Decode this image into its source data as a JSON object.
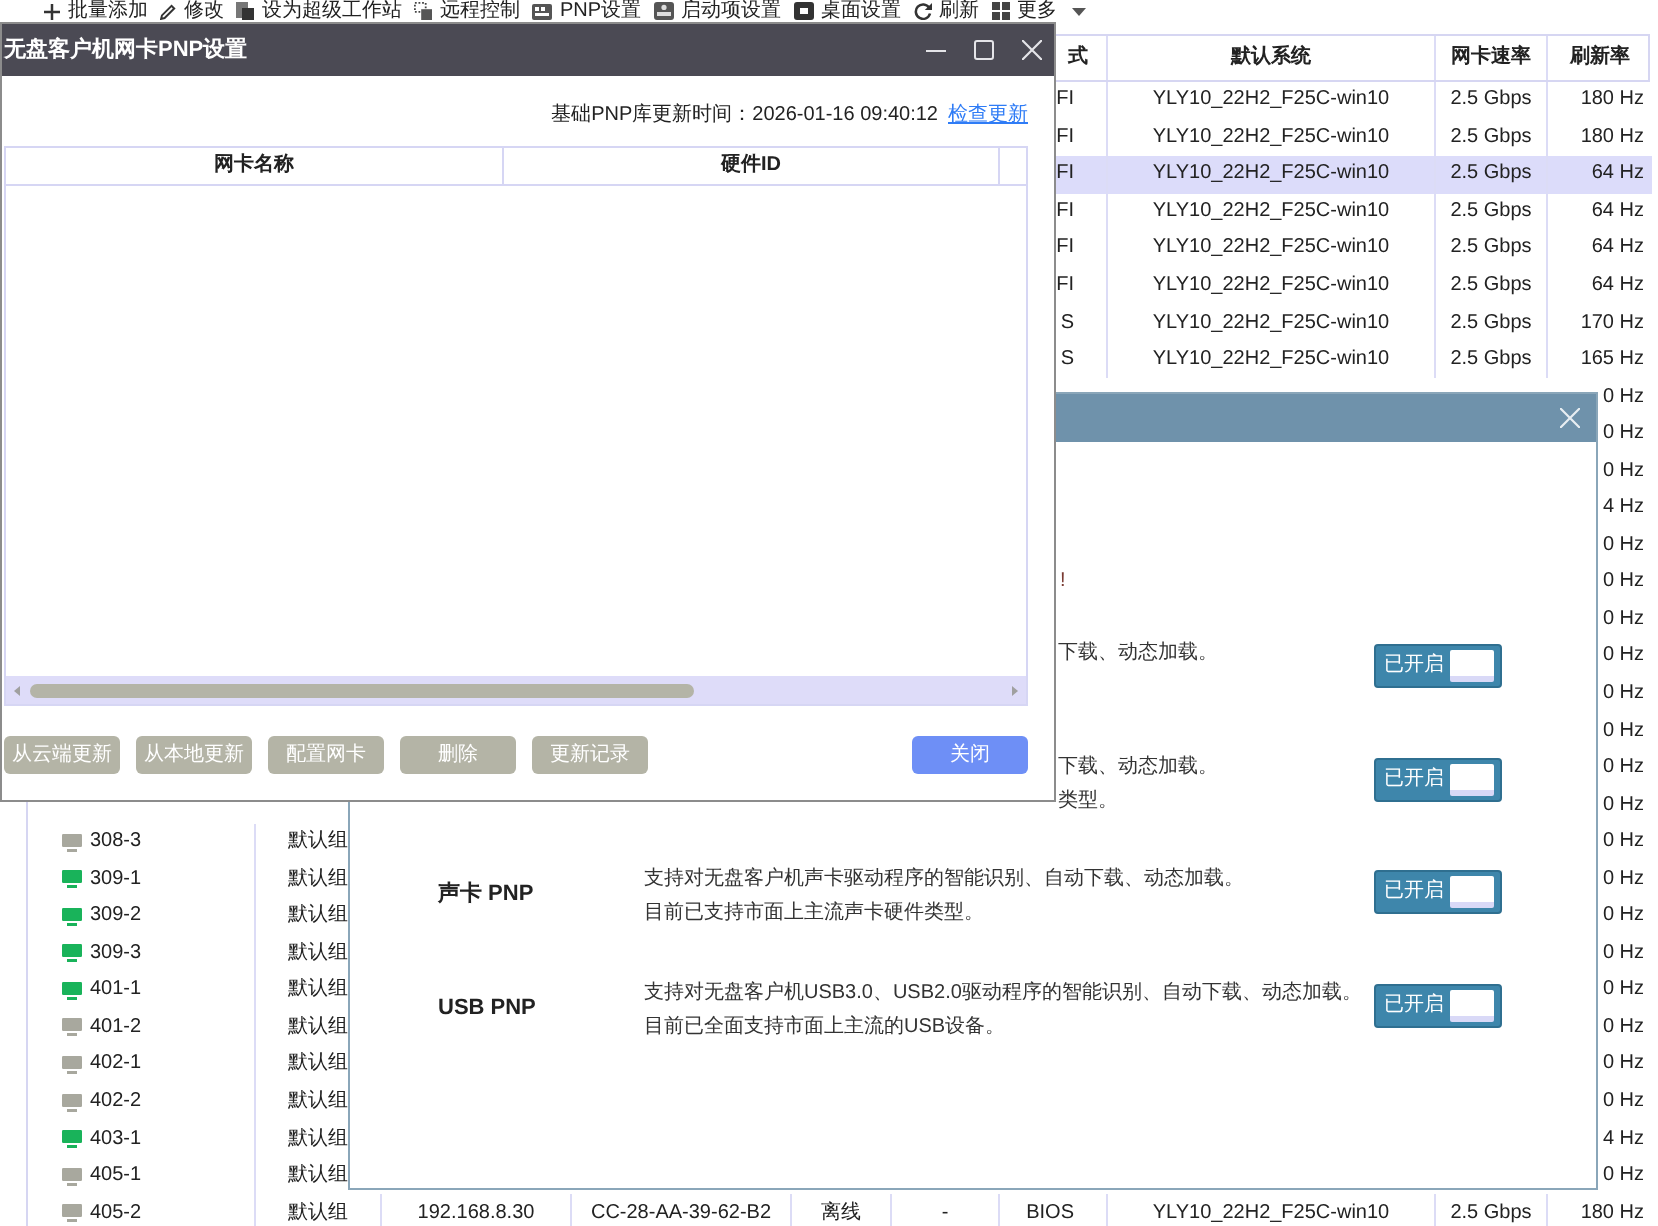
{
  "toolbar": [
    {
      "label": "批量添加",
      "dropdown": false
    },
    {
      "label": "修改",
      "dropdown": false
    },
    {
      "label": "设为超级工作站",
      "dropdown": false
    },
    {
      "label": "远程控制",
      "dropdown": false
    },
    {
      "label": "PNP设置",
      "dropdown": false
    },
    {
      "label": "启动项设置",
      "dropdown": false
    },
    {
      "label": "桌面设置",
      "dropdown": false
    },
    {
      "label": "刷新",
      "dropdown": false
    },
    {
      "label": "更多",
      "dropdown": true
    }
  ],
  "client_table": {
    "columns": [
      "式",
      "默认系统",
      "网卡速率",
      "刷新率"
    ],
    "rows": [
      {
        "selected": false,
        "column_7": "FI",
        "default_system": "YLY10_22H2_F25C-win10",
        "nic_speed": "2.5 Gbps",
        "refresh_rate": "180 Hz"
      },
      {
        "selected": false,
        "column_7": "FI",
        "default_system": "YLY10_22H2_F25C-win10",
        "nic_speed": "2.5 Gbps",
        "refresh_rate": "180 Hz"
      },
      {
        "selected": true,
        "column_7": "FI",
        "default_system": "YLY10_22H2_F25C-win10",
        "nic_speed": "2.5 Gbps",
        "refresh_rate": "64 Hz"
      },
      {
        "selected": false,
        "column_7": "FI",
        "default_system": "YLY10_22H2_F25C-win10",
        "nic_speed": "2.5 Gbps",
        "refresh_rate": "64 Hz"
      },
      {
        "selected": false,
        "column_7": "FI",
        "default_system": "YLY10_22H2_F25C-win10",
        "nic_speed": "2.5 Gbps",
        "refresh_rate": "64 Hz"
      },
      {
        "selected": false,
        "column_7": "FI",
        "default_system": "YLY10_22H2_F25C-win10",
        "nic_speed": "2.5 Gbps",
        "refresh_rate": "64 Hz"
      },
      {
        "selected": false,
        "column_7": "S",
        "default_system": "YLY10_22H2_F25C-win10",
        "nic_speed": "2.5 Gbps",
        "refresh_rate": "170 Hz"
      },
      {
        "selected": false,
        "column_7": "S",
        "default_system": "YLY10_22H2_F25C-win10",
        "nic_speed": "2.5 Gbps",
        "refresh_rate": "165 Hz"
      },
      {
        "selected": false,
        "refresh_rate": "0 Hz"
      },
      {
        "selected": false,
        "refresh_rate": "0 Hz"
      },
      {
        "selected": false,
        "refresh_rate": "0 Hz"
      },
      {
        "selected": false,
        "refresh_rate": "4 Hz"
      },
      {
        "selected": false,
        "refresh_rate": "0 Hz"
      },
      {
        "selected": false,
        "refresh_rate": "0 Hz"
      },
      {
        "selected": false,
        "refresh_rate": "0 Hz"
      },
      {
        "selected": false,
        "refresh_rate": "0 Hz"
      },
      {
        "selected": false,
        "refresh_rate": "0 Hz"
      },
      {
        "selected": false,
        "refresh_rate": "0 Hz"
      },
      {
        "selected": false,
        "refresh_rate": "0 Hz"
      },
      {
        "selected": false,
        "refresh_rate": "0 Hz"
      },
      {
        "selected": false,
        "online": false,
        "column_1": "308-3",
        "column_2": "默认组",
        "refresh_rate": "0 Hz"
      },
      {
        "selected": false,
        "online": true,
        "column_1": "309-1",
        "column_2": "默认组",
        "refresh_rate": "0 Hz"
      },
      {
        "selected": false,
        "online": true,
        "column_1": "309-2",
        "column_2": "默认组",
        "refresh_rate": "0 Hz"
      },
      {
        "selected": false,
        "online": true,
        "column_1": "309-3",
        "column_2": "默认组",
        "refresh_rate": "0 Hz"
      },
      {
        "selected": false,
        "online": true,
        "column_1": "401-1",
        "column_2": "默认组",
        "refresh_rate": "0 Hz"
      },
      {
        "selected": false,
        "online": false,
        "column_1": "401-2",
        "column_2": "默认组",
        "refresh_rate": "0 Hz"
      },
      {
        "selected": false,
        "online": false,
        "column_1": "402-1",
        "column_2": "默认组",
        "refresh_rate": "0 Hz"
      },
      {
        "selected": false,
        "online": false,
        "column_1": "402-2",
        "column_2": "默认组",
        "refresh_rate": "0 Hz"
      },
      {
        "selected": false,
        "online": true,
        "column_1": "403-1",
        "column_2": "默认组",
        "refresh_rate": "4 Hz"
      },
      {
        "selected": false,
        "online": false,
        "column_1": "405-1",
        "column_2": "默认组",
        "refresh_rate": "0 Hz"
      },
      {
        "selected": false,
        "online": false,
        "column_1": "405-2",
        "column_2": "默认组",
        "column_3": "192.168.8.30",
        "column_4": "CC-28-AA-39-62-B2",
        "column_5": "离线",
        "column_6": "-",
        "column_7": "BIOS",
        "default_system": "YLY10_22H2_F25C-win10",
        "nic_speed": "2.5 Gbps",
        "refresh_rate": "180 Hz"
      }
    ]
  },
  "nic_pnp_dialog": {
    "title": "无盘客户机网卡PNP设置",
    "update_time": "基础PNP库更新时间：2026-01-16 09:40:12",
    "check_update_link": "检查更新",
    "table": {
      "columns": [
        "网卡名称",
        "硬件ID"
      ]
    },
    "buttons": [
      {
        "label": "从云端更新",
        "primary": false
      },
      {
        "label": "从本地更新",
        "primary": false
      },
      {
        "label": "配置网卡",
        "primary": false
      },
      {
        "label": "删除",
        "primary": false
      },
      {
        "label": "更新记录",
        "primary": false
      },
      {
        "label": "关闭",
        "primary": true
      }
    ]
  },
  "pnp_dialog": {
    "notice": "!",
    "features": [
      {
        "description": [
          "下载、动态加载。"
        ],
        "switch_label": "已开启",
        "on": true
      },
      {
        "description": [
          "下载、动态加载。",
          "类型。"
        ],
        "switch_label": "已开启",
        "on": true
      },
      {
        "name": "声卡 PNP",
        "description": [
          "支持对无盘客户机声卡驱动程序的智能识别、自动下载、动态加载。",
          "目前已支持市面上主流声卡硬件类型。"
        ],
        "switch_label": "已开启",
        "on": true
      },
      {
        "name": "USB PNP",
        "description": [
          "支持对无盘客户机USB3.0、USB2.0驱动程序的智能识别、自动下载、动态加载。",
          "目前已全面支持市面上主流的USB设备。"
        ],
        "switch_label": "已开启",
        "on": true
      }
    ]
  }
}
